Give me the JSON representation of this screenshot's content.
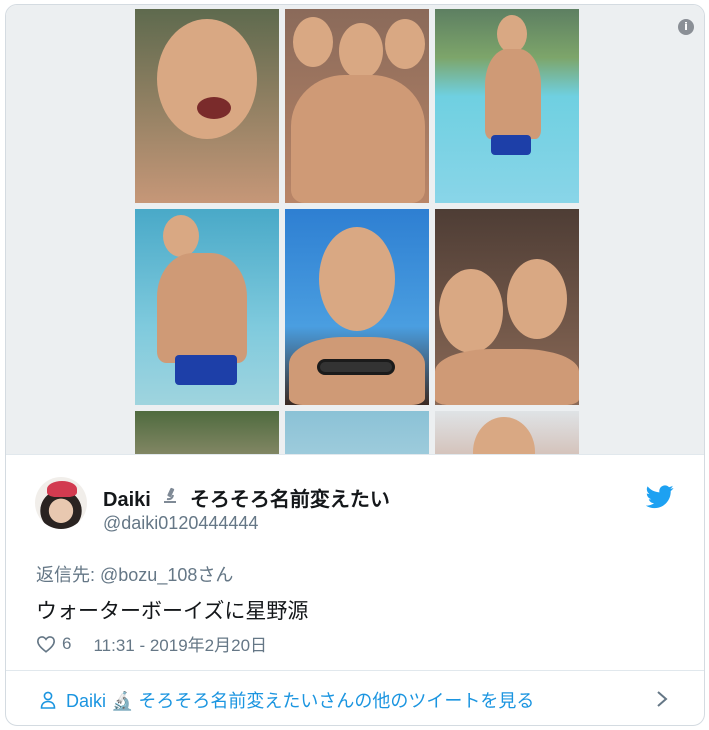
{
  "tweet": {
    "display_name": "Daiki",
    "name_emoji": "microscope-emoji",
    "name_suffix": "そろそろ名前変えたい",
    "handle": "@daiki0120444444",
    "reply_prefix": "返信先: ",
    "reply_to": "@bozu_108さん",
    "text": "ウォーターボーイズに星野源",
    "like_count": "6",
    "timestamp": "11:31 - 2019年2月20日"
  },
  "footer": {
    "more_tweets_label": "Daiki 🔬 そろそろ名前変えたいさんの他のツイートを見る"
  },
  "icons": {
    "info": "info-icon",
    "twitter": "twitter-bird-icon",
    "heart": "heart-icon",
    "person": "person-icon",
    "chevron": "chevron-right-icon"
  },
  "colors": {
    "link": "#1b95e0",
    "secondary_text": "#657786",
    "twitter_blue": "#1da1f2"
  }
}
